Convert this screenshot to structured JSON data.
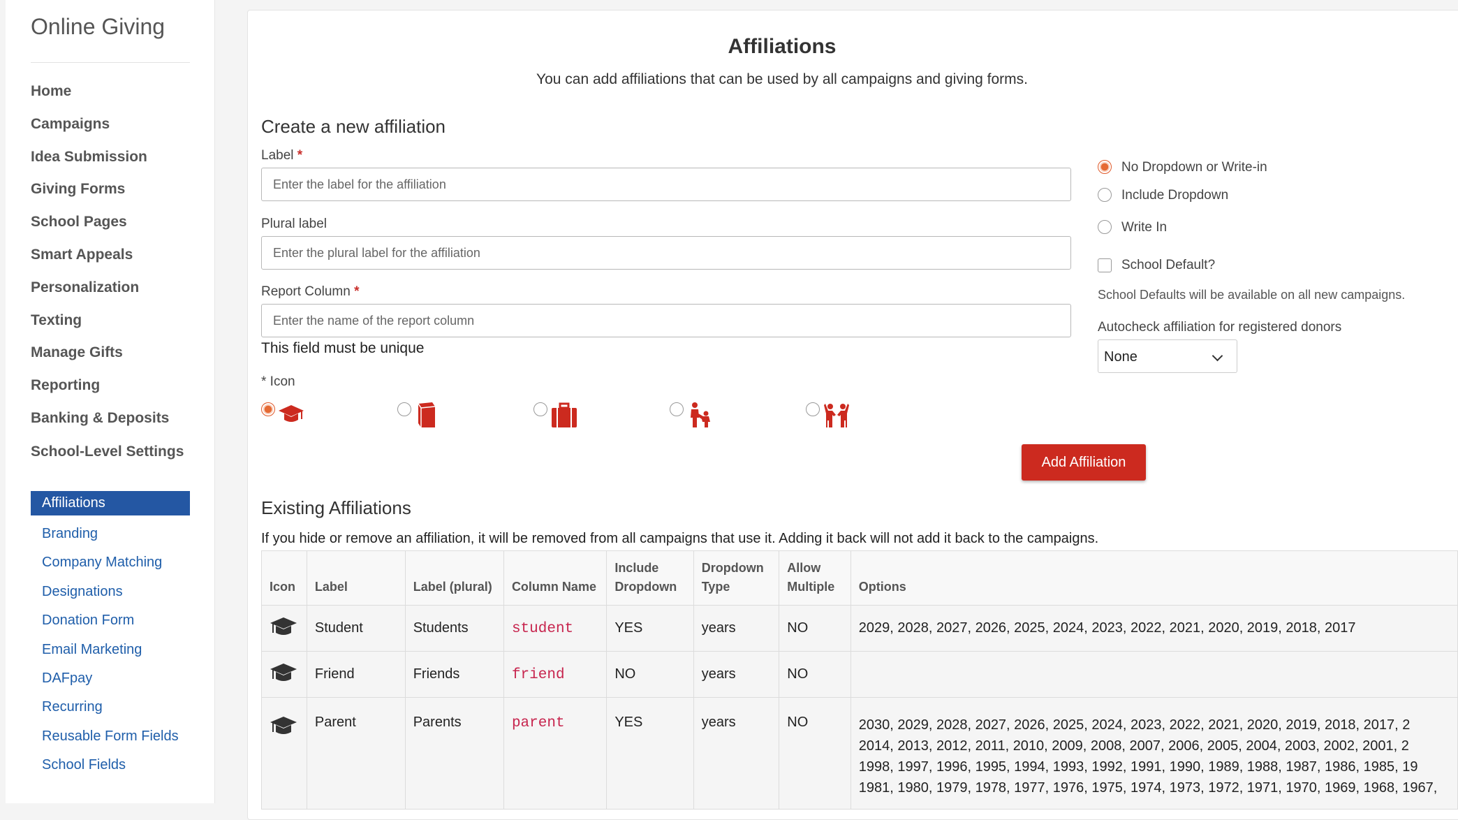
{
  "app_title": "Online Giving",
  "nav_main": [
    "Home",
    "Campaigns",
    "Idea Submission",
    "Giving Forms",
    "School Pages",
    "Smart Appeals",
    "Personalization",
    "Texting",
    "Manage Gifts",
    "Reporting",
    "Banking & Deposits",
    "School-Level Settings"
  ],
  "nav_sub": [
    "Affiliations",
    "Branding",
    "Company Matching",
    "Designations",
    "Donation Form",
    "Email Marketing",
    "DAFpay",
    "Recurring",
    "Reusable Form Fields",
    "School Fields"
  ],
  "nav_sub_active": "Affiliations",
  "page": {
    "title": "Affiliations",
    "subtitle": "You can add affiliations that can be used by all campaigns and giving forms."
  },
  "create": {
    "heading": "Create a new affiliation",
    "label_field": {
      "label": "Label",
      "required_mark": "*",
      "placeholder": "Enter the label for the affiliation"
    },
    "plural_field": {
      "label": "Plural label",
      "placeholder": "Enter the plural label for the affiliation"
    },
    "report_field": {
      "label": "Report Column",
      "required_mark": "*",
      "placeholder": "Enter the name of the report column",
      "note": "This field must be unique"
    },
    "icon_label": "* Icon",
    "icons": [
      "graduation-cap-icon",
      "book-icon",
      "briefcase-icon",
      "parent-child-icon",
      "children-icon"
    ],
    "icon_selected_index": 0,
    "dropdown_options": [
      "No Dropdown or Write-in",
      "Include Dropdown",
      "Write In"
    ],
    "dropdown_selected_index": 0,
    "school_default_label": "School Default?",
    "school_default_note": "School Defaults will be available on all new campaigns.",
    "autocheck_label": "Autocheck affiliation for registered donors",
    "autocheck_value": "None",
    "add_button": "Add Affiliation"
  },
  "existing": {
    "heading": "Existing Affiliations",
    "note": "If you hide or remove an affiliation, it will be removed from all campaigns that use it. Adding it back will not add it back to the campaigns.",
    "columns": [
      "Icon",
      "Label",
      "Label (plural)",
      "Column Name",
      "Include Dropdown",
      "Dropdown Type",
      "Allow Multiple",
      "Options"
    ],
    "rows": [
      {
        "icon": "graduation-cap-icon",
        "label": "Student",
        "plural": "Students",
        "column": "student",
        "include_dropdown": "YES",
        "dropdown_type": "years",
        "allow_multiple": "NO",
        "options": "2029, 2028, 2027, 2026, 2025, 2024, 2023, 2022, 2021, 2020, 2019, 2018, 2017"
      },
      {
        "icon": "graduation-cap-icon",
        "label": "Friend",
        "plural": "Friends",
        "column": "friend",
        "include_dropdown": "NO",
        "dropdown_type": "years",
        "allow_multiple": "NO",
        "options": ""
      },
      {
        "icon": "graduation-cap-icon",
        "label": "Parent",
        "plural": "Parents",
        "column": "parent",
        "include_dropdown": "YES",
        "dropdown_type": "years",
        "allow_multiple": "NO",
        "options_lines": [
          "2030, 2029, 2028, 2027, 2026, 2025, 2024, 2023, 2022, 2021, 2020, 2019, 2018, 2017, 2",
          "2014, 2013, 2012, 2011, 2010, 2009, 2008, 2007, 2006, 2005, 2004, 2003, 2002, 2001, 2",
          "1998, 1997, 1996, 1995, 1994, 1993, 1992, 1991, 1990, 1989, 1988, 1987, 1986, 1985, 19",
          "1981, 1980, 1979, 1978, 1977, 1976, 1975, 1974, 1973, 1972, 1971, 1970, 1969, 1968, 1967,"
        ]
      }
    ]
  },
  "colors": {
    "accent_red": "#cc2a1f",
    "active_nav": "#2457a3",
    "link_blue": "#1f5eaa",
    "radio_orange": "#e56a34"
  }
}
